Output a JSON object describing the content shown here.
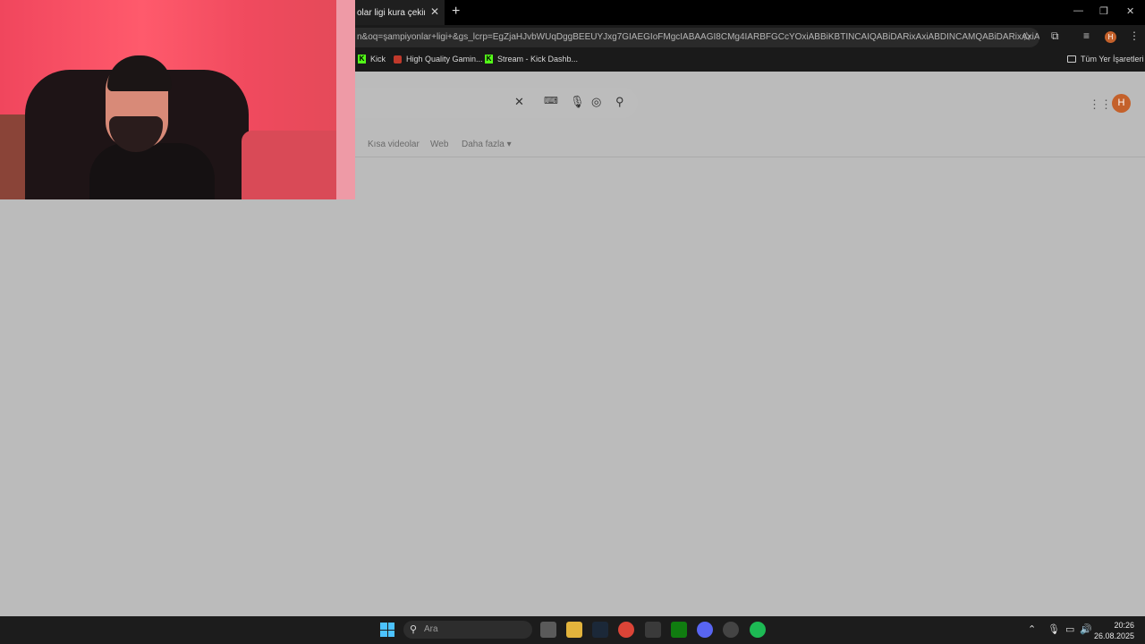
{
  "browser": {
    "tab_title": "olar ligi kura çekimi ne",
    "tab_close": "✕",
    "new_tab": "+",
    "url": "n&oq=şampiyonlar+ligi+&gs_lcrp=EgZjaHJvbWUqDggBEEUYJxg7GIAEGIoFMgcIABAAGI8CMg4IARBFGCcYOxiABBiKBTINCAIQABiDARixAxiABDINCAMQABiDARixAxiABDINCAQQA...",
    "window_controls": [
      "—",
      "❐",
      "✕"
    ]
  },
  "bookmarks": {
    "items": [
      {
        "label": "Kick"
      },
      {
        "label": "High Quality Gamin..."
      },
      {
        "label": "Stream - Kick Dashb..."
      }
    ],
    "all_bookmarks": "Tüm Yer İşaretleri"
  },
  "search": {
    "tabs": [
      "Kısa videolar",
      "Web",
      "Daha fazla"
    ],
    "avatar_letter": "H"
  },
  "taskbar": {
    "search_placeholder": "Ara",
    "time": "20:26",
    "date": "26.08.2025"
  }
}
